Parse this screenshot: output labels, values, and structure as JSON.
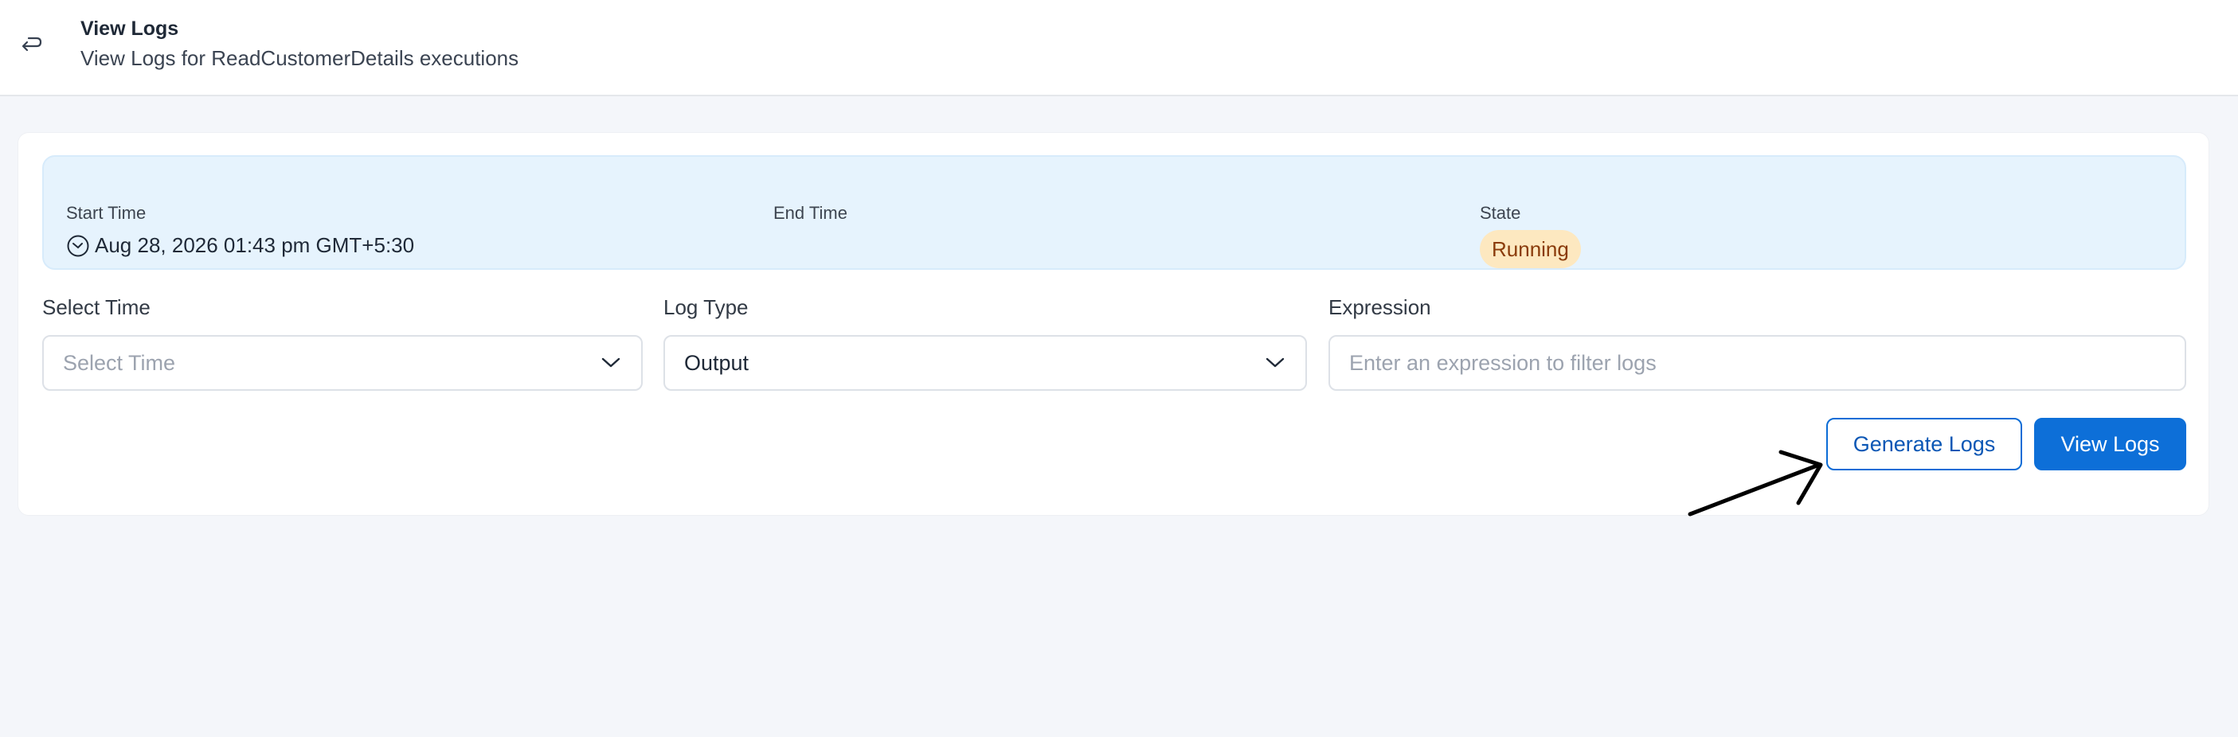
{
  "header": {
    "title": "View Logs",
    "subtitle": "View Logs for ReadCustomerDetails executions",
    "back_icon": "return-arrow-icon"
  },
  "execution": {
    "start_time_label": "Start Time",
    "start_time_value": "Aug 28, 2026 01:43 pm GMT+5:30",
    "end_time_label": "End Time",
    "end_time_value": "",
    "state_label": "State",
    "state_value": "Running"
  },
  "filters": {
    "select_time": {
      "label": "Select Time",
      "placeholder": "Select Time",
      "value": ""
    },
    "log_type": {
      "label": "Log Type",
      "value": "Output"
    },
    "expression": {
      "label": "Expression",
      "placeholder": "Enter an expression to filter logs",
      "value": ""
    }
  },
  "actions": {
    "generate_label": "Generate Logs",
    "view_label": "View Logs"
  },
  "colors": {
    "primary": "#0d6fd8",
    "info_panel": "#e6f3fd",
    "badge_bg": "#fde8c0",
    "badge_text": "#8a3b0a",
    "background": "#f4f6fa"
  }
}
